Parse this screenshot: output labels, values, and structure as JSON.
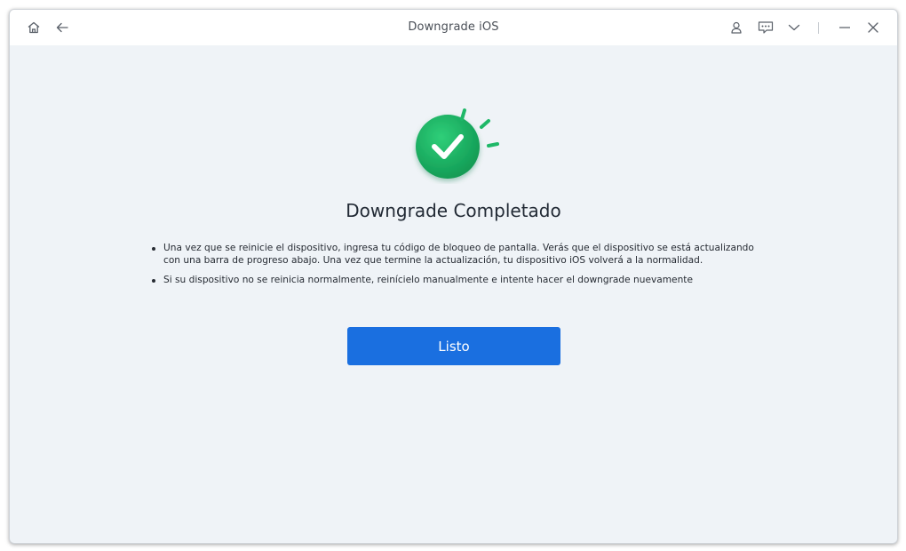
{
  "window": {
    "title": "Downgrade iOS"
  },
  "titlebar": {
    "left_icons": [
      "home-icon",
      "back-arrow-icon"
    ],
    "right_icons": [
      "user-icon",
      "feedback-icon",
      "chevron-down-icon",
      "minimize-icon",
      "close-icon"
    ]
  },
  "main": {
    "status_icon": "success-check-icon",
    "heading": "Downgrade Completado",
    "notes": [
      "Una vez que se reinicie el dispositivo, ingresa tu código de bloqueo de pantalla. Verás que el dispositivo se está actualizando con una barra de progreso abajo. Una vez que termine la actualización, tu dispositivo iOS volverá a la normalidad.",
      "Si su dispositivo no se reinicia normalmente, reinícielo manualmente e intente hacer el downgrade nuevamente"
    ],
    "done_button": "Listo"
  },
  "colors": {
    "accent": "#1a6fe0",
    "success": "#1fb868",
    "background": "#eff3f7"
  }
}
